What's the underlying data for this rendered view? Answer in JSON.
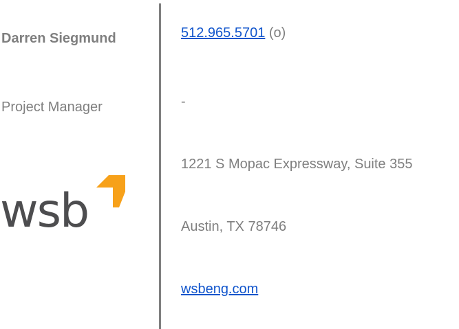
{
  "contact": {
    "name": "Darren Siegmund",
    "title": "Project Manager"
  },
  "logo": {
    "text": "wsb",
    "arrow_color": "#f7a11a",
    "text_color": "#4d4d4f"
  },
  "details": {
    "phone": "512.965.5701",
    "phone_suffix": " (o)",
    "secondary": "-",
    "address_line1": "1221 S Mopac Expressway, Suite 355",
    "address_line2": "Austin, TX 78746",
    "website": "wsbeng.com"
  },
  "colors": {
    "text": "#7f7f7f",
    "link": "#1155cc",
    "divider": "#7f7f7f"
  }
}
